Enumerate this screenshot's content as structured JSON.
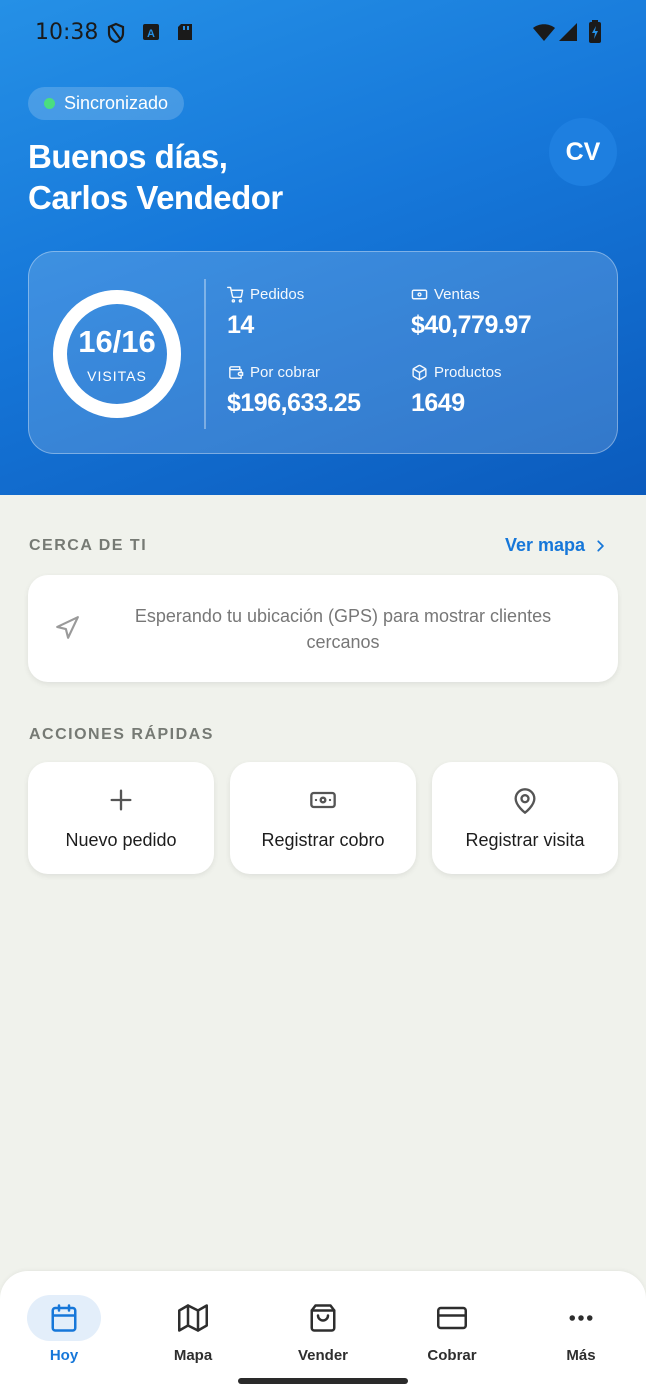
{
  "status_bar": {
    "time": "10:38"
  },
  "header": {
    "sync_label": "Sincronizado",
    "greeting_line1": "Buenos días,",
    "greeting_line2": "Carlos Vendedor",
    "avatar_initials": "CV"
  },
  "stats": {
    "visits_value": "16/16",
    "visits_done": 16,
    "visits_total": 16,
    "visits_label": "VISITAS",
    "pedidos_label": "Pedidos",
    "pedidos_value": "14",
    "ventas_label": "Ventas",
    "ventas_value": "$40,779.97",
    "por_cobrar_label": "Por cobrar",
    "por_cobrar_value": "$196,633.25",
    "productos_label": "Productos",
    "productos_value": "1649"
  },
  "nearby": {
    "title": "CERCA DE TI",
    "map_link": "Ver mapa",
    "gps_message": "Esperando tu ubicación (GPS) para mostrar clientes cercanos"
  },
  "quick_actions": {
    "title": "ACCIONES RÁPIDAS",
    "items": [
      {
        "label": "Nuevo pedido",
        "icon": "plus-icon"
      },
      {
        "label": "Registrar cobro",
        "icon": "cash-icon"
      },
      {
        "label": "Registrar visita",
        "icon": "map-pin-icon"
      }
    ]
  },
  "bottom_nav": {
    "items": [
      {
        "label": "Hoy",
        "icon": "calendar-icon",
        "active": true
      },
      {
        "label": "Mapa",
        "icon": "map-icon"
      },
      {
        "label": "Vender",
        "icon": "shopping-bag-icon"
      },
      {
        "label": "Cobrar",
        "icon": "credit-card-icon"
      },
      {
        "label": "Más",
        "icon": "more-icon"
      }
    ]
  },
  "colors": {
    "accent": "#1677d9",
    "header_gradient_start": "#2590e6",
    "header_gradient_end": "#0b5bbd",
    "sync_dot": "#4ade80",
    "background": "#f0f2ec"
  }
}
